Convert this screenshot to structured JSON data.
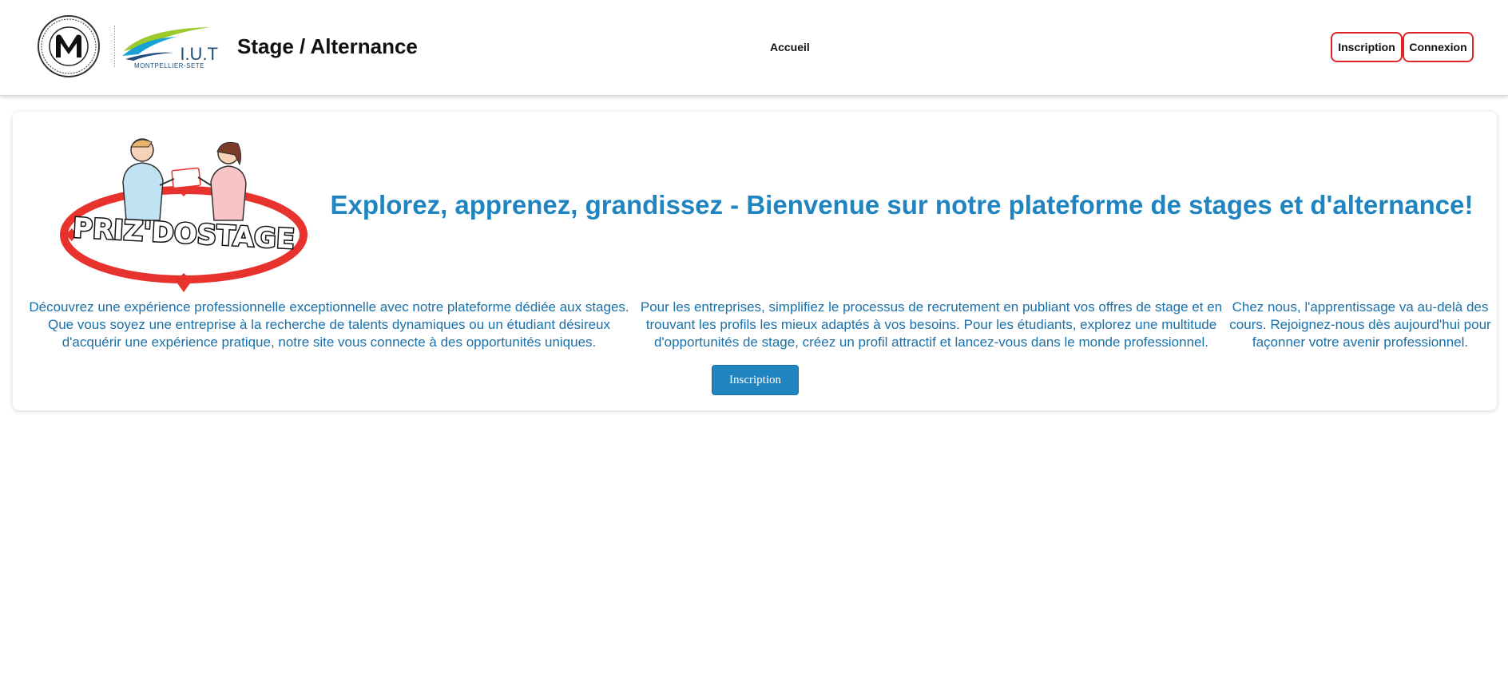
{
  "header": {
    "site_title": "Stage / Alternance",
    "iut_logo_text": "I.U.T",
    "iut_logo_caption": "MONTPELLIER-SETE",
    "nav": [
      {
        "label": "Accueil"
      }
    ],
    "inscription_label": "Inscription",
    "connexion_label": "Connexion"
  },
  "hero": {
    "brand_logo_text": "PRIZ'DOSTAGE",
    "headline": "Explorez, apprenez, grandissez - Bienvenue sur notre plateforme de stages et d'alternance!",
    "paragraphs": [
      "Découvrez une expérience professionnelle exceptionnelle avec notre plateforme dédiée aux stages. Que vous soyez une entreprise à la recherche de talents dynamiques ou un étudiant désireux d'acquérir une expérience pratique, notre site vous connecte à des opportunités uniques.",
      "Pour les entreprises, simplifiez le processus de recrutement en publiant vos offres de stage et en trouvant les profils les mieux adaptés à vos besoins. Pour les étudiants, explorez une multitude d'opportunités de stage, créez un profil attractif et lancez-vous dans le monde professionnel.",
      "Chez nous, l'apprentissage va au-delà des cours. Rejoignez-nous dès aujourd'hui pour façonner votre avenir professionnel."
    ],
    "cta_label": "Inscription"
  },
  "colors": {
    "accent": "#1f84bf",
    "text_blue": "#1a70a8",
    "auth_border": "#e0252a",
    "logo_red": "#e8322d"
  }
}
